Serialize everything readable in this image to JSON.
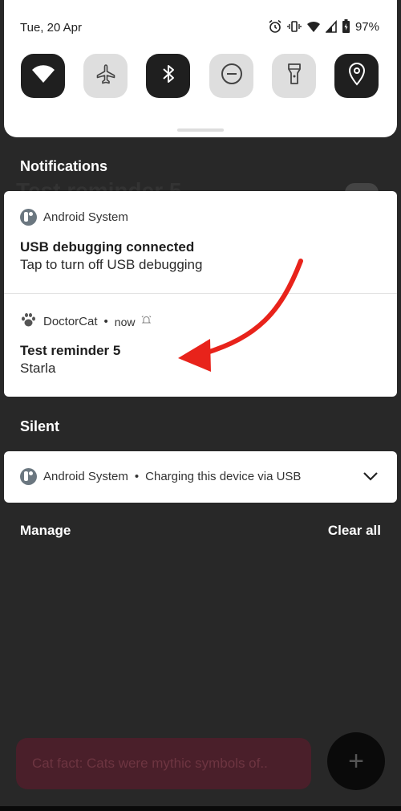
{
  "status_bar": {
    "date": "Tue, 20 Apr",
    "battery": "97%"
  },
  "quick_settings": {
    "tiles": [
      {
        "name": "wifi",
        "state": "on"
      },
      {
        "name": "airplane-mode",
        "state": "off"
      },
      {
        "name": "bluetooth",
        "state": "on"
      },
      {
        "name": "do-not-disturb",
        "state": "off"
      },
      {
        "name": "flashlight",
        "state": "off"
      },
      {
        "name": "location",
        "state": "on"
      }
    ]
  },
  "sections": {
    "notifications": "Notifications",
    "silent": "Silent"
  },
  "background_notification": {
    "title": "Test reminder 5"
  },
  "notifications": [
    {
      "app": "Android System",
      "title": "USB debugging connected",
      "text": "Tap to turn off USB debugging"
    },
    {
      "app": "DoctorCat",
      "time": "now",
      "bullet": "•",
      "title": "Test reminder 5",
      "text": "Starla"
    }
  ],
  "silent_notification": {
    "app": "Android System",
    "bullet": "•",
    "text": "Charging this device via USB"
  },
  "footer": {
    "manage": "Manage",
    "clear_all": "Clear all"
  },
  "snackbar": {
    "text": "Cat fact:  Cats were mythic symbols of.."
  },
  "fab": {
    "label": "+"
  },
  "colors": {
    "annotation_arrow": "#e8231b",
    "background": "#282828"
  }
}
